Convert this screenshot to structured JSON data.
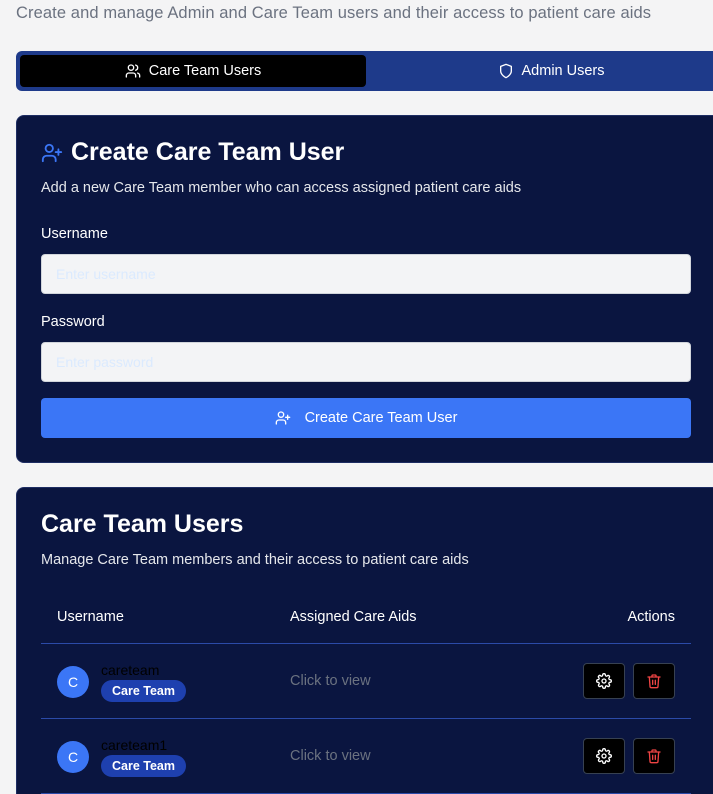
{
  "header": {
    "subtitle": "Create and manage Admin and Care Team users and their access to patient care aids"
  },
  "tabs": [
    {
      "label": "Care Team Users",
      "icon": "users-icon",
      "active": true
    },
    {
      "label": "Admin Users",
      "icon": "shield-icon",
      "active": false
    }
  ],
  "create_form": {
    "title": "Create Care Team User",
    "title_icon": "user-plus-icon",
    "description": "Add a new Care Team member who can access assigned patient care aids",
    "username_label": "Username",
    "username_placeholder": "Enter username",
    "password_label": "Password",
    "password_placeholder": "Enter password",
    "submit_label": "Create Care Team User",
    "submit_icon": "user-plus-icon"
  },
  "users_table": {
    "title": "Care Team Users",
    "description": "Manage Care Team members and their access to patient care aids",
    "columns": [
      "Username",
      "Assigned Care Aids",
      "Actions"
    ],
    "rows": [
      {
        "initial": "C",
        "username": "careteam",
        "role": "Care Team",
        "aids": "Click to view"
      },
      {
        "initial": "C",
        "username": "careteam1",
        "role": "Care Team",
        "aids": "Click to view"
      }
    ]
  },
  "colors": {
    "page_bg": "#f4f4f5",
    "card_bg": "#0a1540",
    "tab_bar": "#1e3a8a",
    "accent": "#3b76f6",
    "badge": "#1e40af",
    "danger": "#ef4444"
  }
}
